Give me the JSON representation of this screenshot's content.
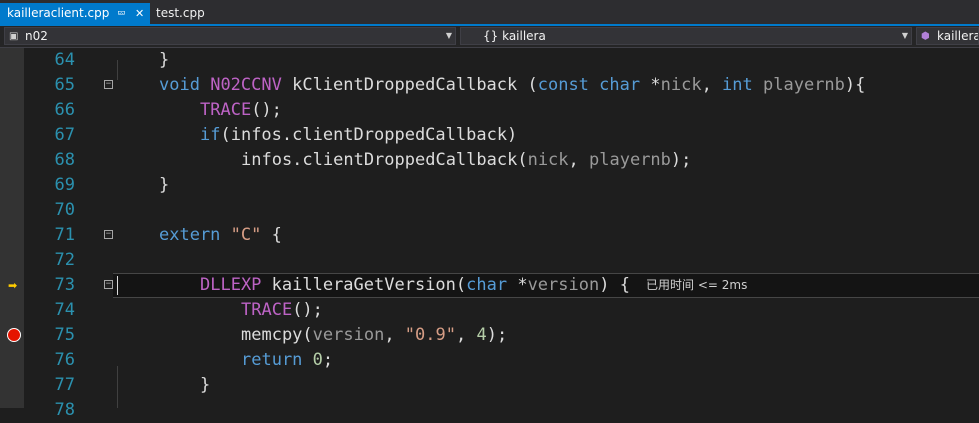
{
  "tabs": [
    {
      "label": "kailleraclient.cpp",
      "active": true,
      "pin_icon": "pin-icon",
      "close_icon": "close-icon"
    },
    {
      "label": "test.cpp",
      "active": false
    }
  ],
  "navbar": {
    "project_scope": "n02",
    "namespace_scope": "{} kaillera",
    "member_scope": "kaillera"
  },
  "colors": {
    "accent": "#007acc",
    "background": "#1e1e1e",
    "line_number": "#2b91af",
    "keyword": "#569cd6",
    "macro": "#bd63c5",
    "parameter": "#9a9a9a",
    "string": "#d69d85",
    "number": "#b5cea8",
    "breakpoint": "#e51400",
    "instruction_pointer": "#ffcc00"
  },
  "code": {
    "l64": {
      "num": "64",
      "t1": "}"
    },
    "l65": {
      "num": "65",
      "t1": "void",
      "t2": " ",
      "t3": "N02CCNV",
      "t4": " kClientDroppedCallback (",
      "t5": "const",
      "t6": " ",
      "t7": "char",
      "t8": " *",
      "t9": "nick",
      "t10": ", ",
      "t11": "int",
      "t12": " ",
      "t13": "playernb",
      "t14": "){"
    },
    "l66": {
      "num": "66",
      "t1": "TRACE",
      "t2": "();"
    },
    "l67": {
      "num": "67",
      "t1": "if",
      "t2": "(infos.clientDroppedCallback)"
    },
    "l68": {
      "num": "68",
      "t1": "infos.clientDroppedCallback(",
      "t2": "nick",
      "t3": ", ",
      "t4": "playernb",
      "t5": ");"
    },
    "l69": {
      "num": "69",
      "t1": "}"
    },
    "l70": {
      "num": "70"
    },
    "l71": {
      "num": "71",
      "t1": "extern",
      "t2": " ",
      "t3": "\"C\"",
      "t4": " {"
    },
    "l72": {
      "num": "72"
    },
    "l73": {
      "num": "73",
      "t1": "DLLEXP",
      "t2": " kailleraGetVersion(",
      "t3": "char",
      "t4": " *",
      "t5": "version",
      "t6": ") {",
      "perf": "已用时间 <= 2ms"
    },
    "l74": {
      "num": "74",
      "t1": "TRACE",
      "t2": "();"
    },
    "l75": {
      "num": "75",
      "t1": "memcpy(",
      "t2": "version",
      "t3": ", ",
      "t4": "\"0.9\"",
      "t5": ", ",
      "t6": "4",
      "t7": ");"
    },
    "l76": {
      "num": "76",
      "t1": "return",
      "t2": " ",
      "t3": "0",
      "t4": ";"
    },
    "l77": {
      "num": "77",
      "t1": "}"
    },
    "l78": {
      "num": "78"
    }
  }
}
